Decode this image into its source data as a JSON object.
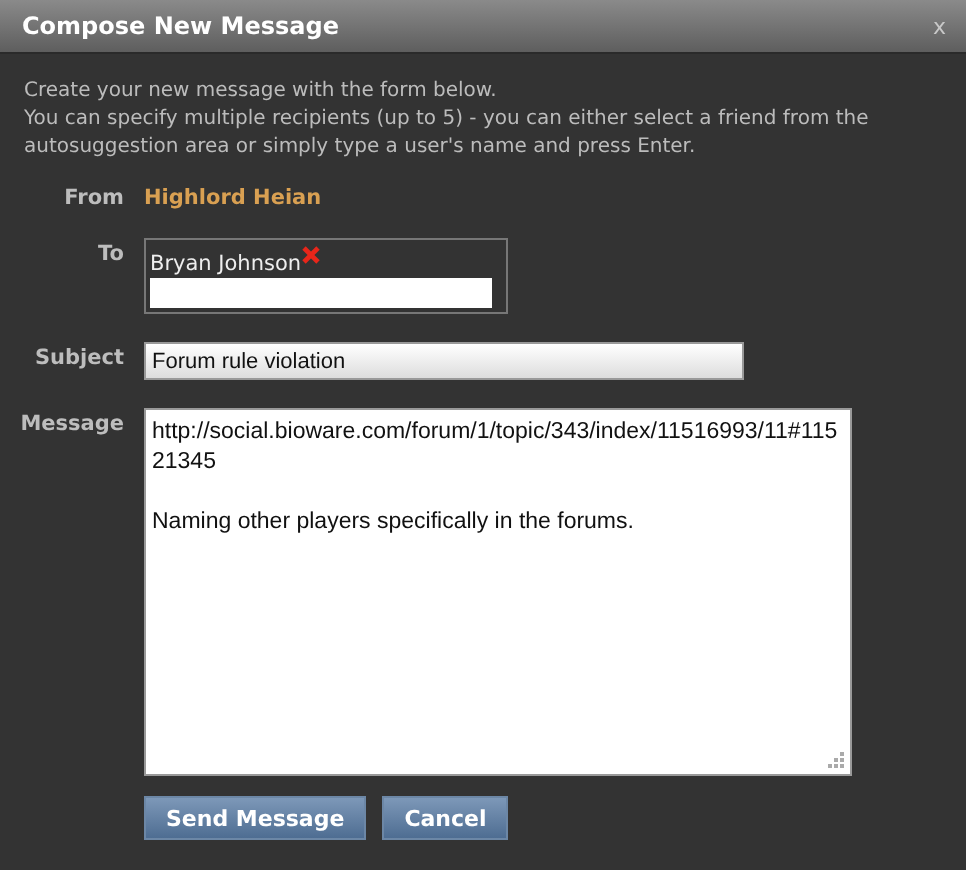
{
  "window": {
    "title": "Compose New Message",
    "close": "x"
  },
  "intro": [
    "Create your new message with the form below.",
    "You can specify multiple recipients (up to 5) - you can either select a friend from the autosuggestion area or simply type a user's name and press Enter."
  ],
  "from": {
    "label": "From",
    "value": "Highlord Heian"
  },
  "to": {
    "label": "To",
    "recipients": [
      "Bryan Johnson"
    ]
  },
  "subject": {
    "label": "Subject",
    "value": "Forum rule violation"
  },
  "message": {
    "label": "Message",
    "value": "http://social.bioware.com/forum/1/topic/343/index/11516993/11#11521345\n\nNaming other players specifically in the forums."
  },
  "buttons": [
    {
      "label": "Send Message",
      "kind": "primary"
    },
    {
      "label": "Cancel",
      "kind": "secondary"
    }
  ]
}
